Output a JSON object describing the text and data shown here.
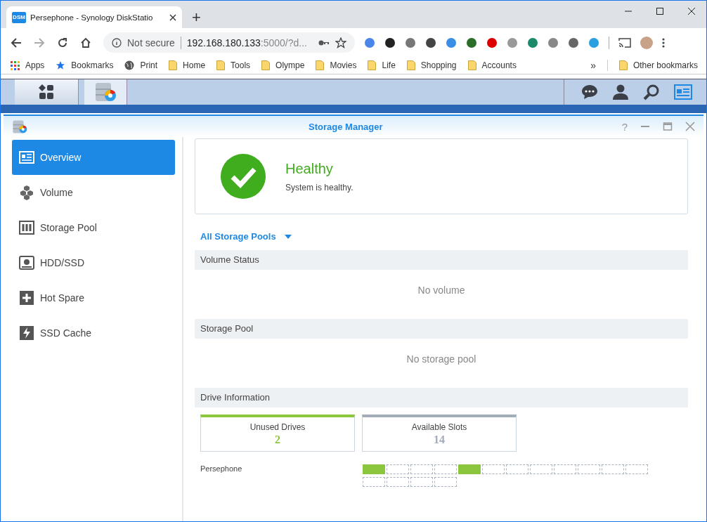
{
  "browser": {
    "tab_title": "Persephone - Synology DiskStatio",
    "tab_favicon": "DSM",
    "new_tab": "+",
    "address_secure": "Not secure",
    "address_host": "192.168.180.133",
    "address_rest": ":5000/?d...",
    "bookmarks": [
      {
        "label": "Apps",
        "kind": "apps"
      },
      {
        "label": "Bookmarks",
        "kind": "star"
      },
      {
        "label": "Print",
        "kind": "globe"
      },
      {
        "label": "Home",
        "kind": "folder"
      },
      {
        "label": "Tools",
        "kind": "folder"
      },
      {
        "label": "Olympe",
        "kind": "folder"
      },
      {
        "label": "Movies",
        "kind": "folder"
      },
      {
        "label": "Life",
        "kind": "folder"
      },
      {
        "label": "Shopping",
        "kind": "folder"
      },
      {
        "label": "Accounts",
        "kind": "folder"
      }
    ],
    "more": "»",
    "other_bookmarks": "Other bookmarks"
  },
  "window": {
    "title": "Storage Manager",
    "help": "?"
  },
  "sidebar": {
    "items": [
      {
        "label": "Overview",
        "kind": "overview",
        "selected": true
      },
      {
        "label": "Volume",
        "kind": "volume",
        "selected": false
      },
      {
        "label": "Storage Pool",
        "kind": "pool",
        "selected": false
      },
      {
        "label": "HDD/SSD",
        "kind": "hdd",
        "selected": false
      },
      {
        "label": "Hot Spare",
        "kind": "spare",
        "selected": false
      },
      {
        "label": "SSD Cache",
        "kind": "cache",
        "selected": false
      }
    ]
  },
  "status": {
    "title": "Healthy",
    "message": "System is healthy."
  },
  "pool_selector": "All Storage Pools",
  "sections": [
    {
      "title": "Volume Status",
      "empty": "No volume"
    },
    {
      "title": "Storage Pool",
      "empty": "No storage pool"
    },
    {
      "title": "Drive Information"
    }
  ],
  "drive_cards": [
    {
      "label": "Unused Drives",
      "value": "2",
      "color": "#8cc63f"
    },
    {
      "label": "Available Slots",
      "value": "14",
      "color": "#a3acb9"
    }
  ],
  "device": {
    "name": "Persephone",
    "slots": [
      {
        "used": true
      },
      {
        "used": false
      },
      {
        "used": false
      },
      {
        "used": false
      },
      {
        "used": true
      },
      {
        "used": false
      },
      {
        "used": false
      },
      {
        "used": false
      },
      {
        "used": false
      },
      {
        "used": false
      },
      {
        "used": false
      },
      {
        "used": false
      },
      {
        "used": false
      },
      {
        "used": false
      },
      {
        "used": false
      },
      {
        "used": false
      }
    ]
  }
}
